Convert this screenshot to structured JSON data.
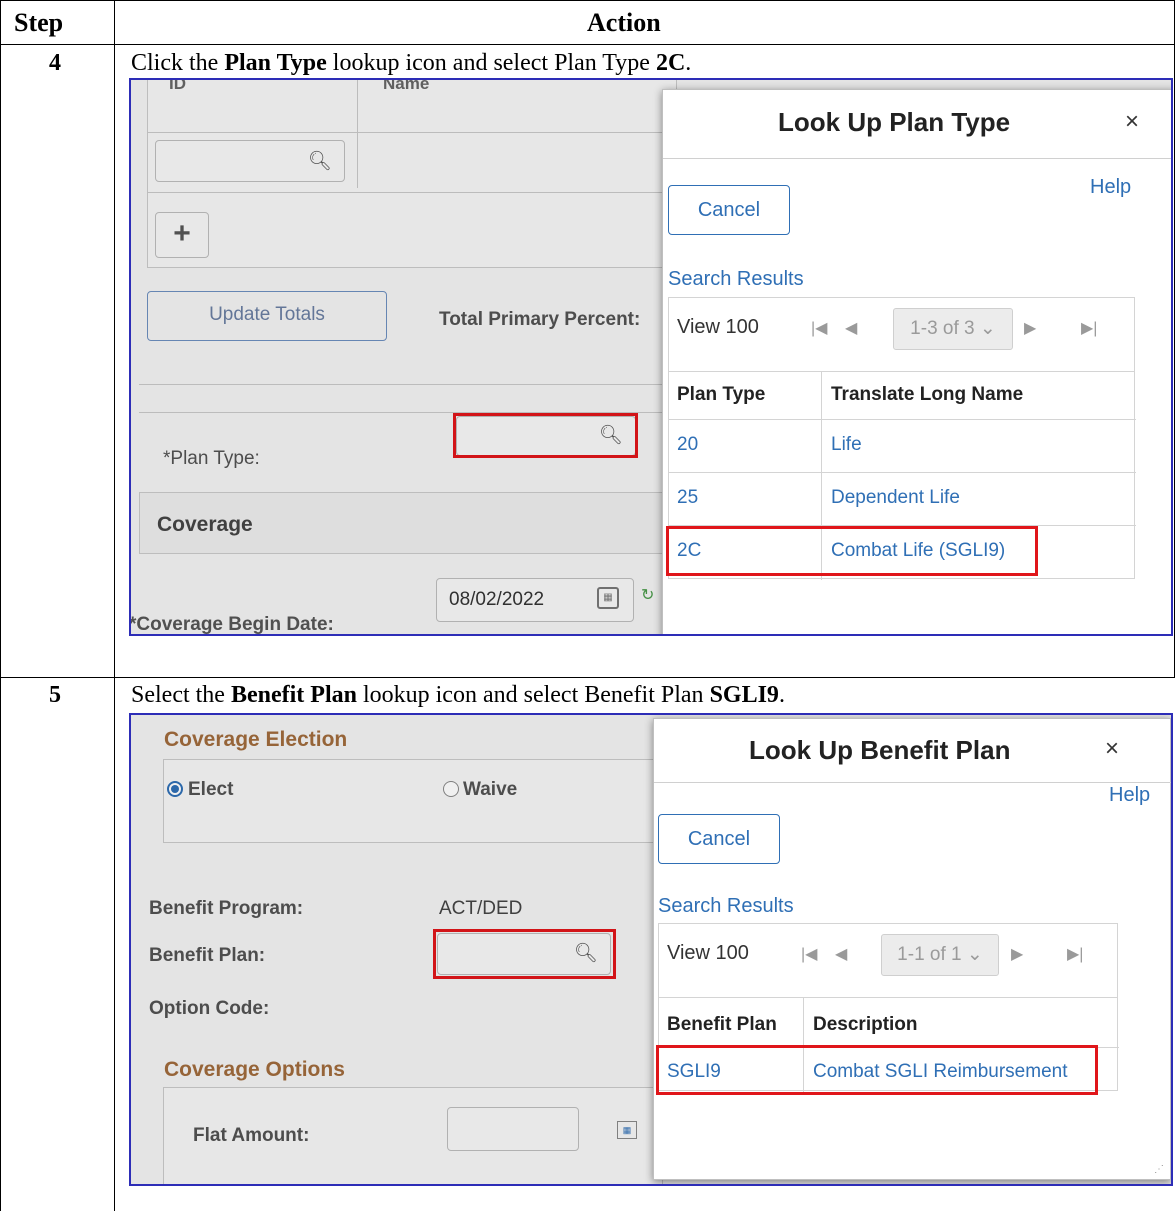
{
  "table": {
    "header_step": "Step",
    "header_action": "Action"
  },
  "steps": [
    {
      "number": "4",
      "instruction": {
        "pre": "Click the ",
        "bold1": "Plan Type",
        "mid": " lookup icon and select Plan Type ",
        "bold2": "2C",
        "post": "."
      },
      "background": {
        "col_id": "ID",
        "col_name": "Name",
        "add_icon": "plus-icon",
        "update_totals": "Update Totals",
        "total_primary_percent": "Total Primary Percent:",
        "plan_type_label": "*Plan Type:",
        "coverage_header": "Coverage",
        "coverage_begin_date_label": "*Coverage Begin Date:",
        "coverage_begin_date_value": "08/02/2022"
      },
      "modal": {
        "title": "Look Up Plan Type",
        "close": "×",
        "help": "Help",
        "cancel": "Cancel",
        "search_results": "Search Results",
        "view_all": "View 100",
        "pager": "1-3 of 3",
        "columns": [
          "Plan Type",
          "Translate Long Name"
        ],
        "rows": [
          [
            "20",
            "Life"
          ],
          [
            "25",
            "Dependent Life"
          ],
          [
            "2C",
            "Combat Life (SGLI9)"
          ]
        ]
      }
    },
    {
      "number": "5",
      "instruction": {
        "pre": "Select the ",
        "bold1": "Benefit Plan",
        "mid": " lookup icon and select Benefit Plan ",
        "bold2": "SGLI9",
        "post": "."
      },
      "background": {
        "coverage_election": "Coverage Election",
        "elect": "Elect",
        "waive": "Waive",
        "benefit_program_label": "Benefit Program:",
        "benefit_program_value": "ACT/DED",
        "benefit_plan_label": "Benefit Plan:",
        "option_code_label": "Option Code:",
        "coverage_options": "Coverage Options",
        "flat_amount_label": "Flat Amount:"
      },
      "modal": {
        "title": "Look Up Benefit Plan",
        "close": "×",
        "help": "Help",
        "cancel": "Cancel",
        "search_results": "Search Results",
        "view_all": "View 100",
        "pager": "1-1 of 1",
        "columns": [
          "Benefit Plan",
          "Description"
        ],
        "rows": [
          [
            "SGLI9",
            "Combat SGLI Reimbursement"
          ]
        ]
      }
    }
  ],
  "colors": {
    "link": "#2f6fb5",
    "highlight": "#e0161a",
    "screenshot_border": "#2d2db7",
    "section_label": "#a06b3c"
  }
}
